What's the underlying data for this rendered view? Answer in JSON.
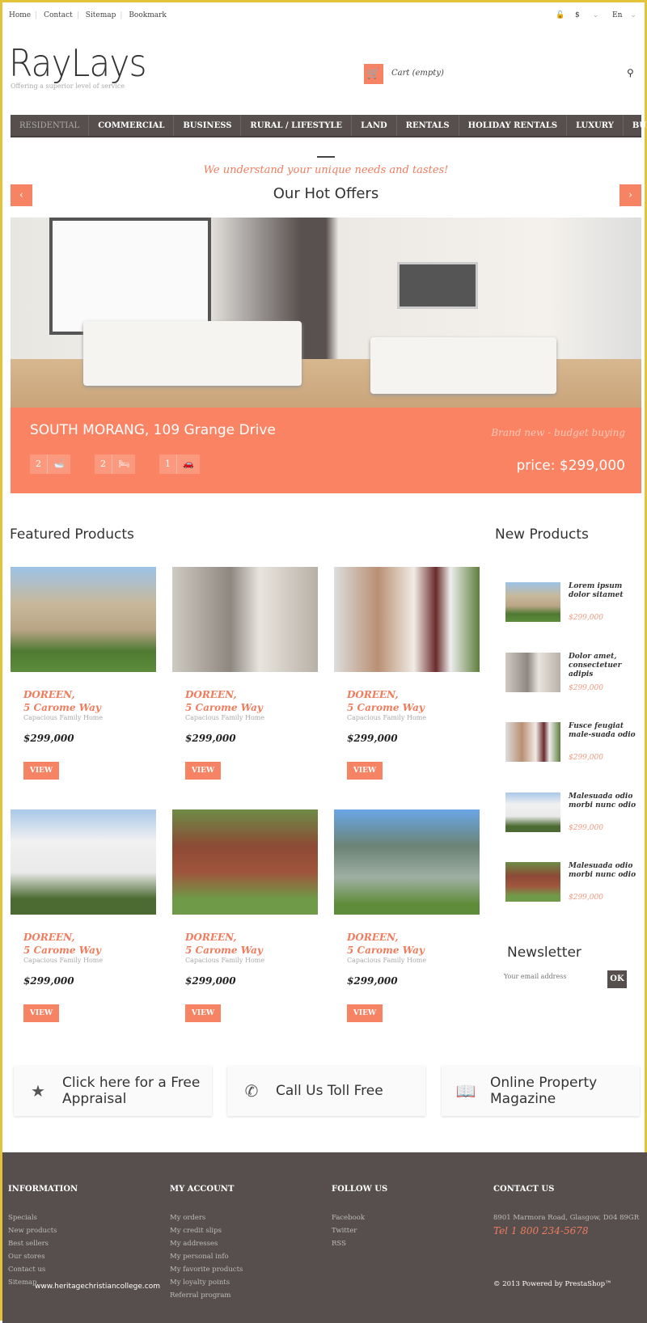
{
  "topnav": [
    "Home",
    "Contact",
    "Sitemap",
    "Bookmark"
  ],
  "top_right": {
    "currency": "$",
    "language": "En"
  },
  "logo": {
    "name": "RayLays",
    "slogan": "Offering a superior level of service"
  },
  "cart": {
    "label": "Cart (empty)"
  },
  "menu": [
    "RESIDENTIAL",
    "COMMERCIAL",
    "BUSINESS",
    "RURAL / LIFESTYLE",
    "LAND",
    "RENTALS",
    "HOLIDAY RENTALS",
    "LUXURY",
    "BUDGET"
  ],
  "slider": {
    "tagline": "We understand your unique needs and tastes!",
    "title": "Our Hot Offers",
    "address": "SOUTH MORANG, 109 Grange Drive",
    "subtitle": "Brand new - budget buying",
    "price": "price: $299,000",
    "baths": "2",
    "beds": "2",
    "cars": "1"
  },
  "featured": {
    "title": "Featured Products",
    "items": [
      {
        "name1": "DOREEN,",
        "name2": "5 Carome Way",
        "desc": "Capacious Family Home",
        "price": "$299,000",
        "button": "VIEW"
      },
      {
        "name1": "DOREEN,",
        "name2": "5 Carome Way",
        "desc": "Capacious Family Home",
        "price": "$299,000",
        "button": "VIEW"
      },
      {
        "name1": "DOREEN,",
        "name2": "5 Carome Way",
        "desc": "Capacious Family Home",
        "price": "$299,000",
        "button": "VIEW"
      },
      {
        "name1": "DOREEN,",
        "name2": "5 Carome Way",
        "desc": "Capacious Family Home",
        "price": "$299,000",
        "button": "VIEW"
      },
      {
        "name1": "DOREEN,",
        "name2": "5 Carome Way",
        "desc": "Capacious Family Home",
        "price": "$299,000",
        "button": "VIEW"
      },
      {
        "name1": "DOREEN,",
        "name2": "5 Carome Way",
        "desc": "Capacious Family Home",
        "price": "$299,000",
        "button": "VIEW"
      }
    ]
  },
  "new_products": {
    "title": "New Products",
    "items": [
      {
        "name": "Lorem ipsum dolor sitamet",
        "price": "$299,000"
      },
      {
        "name": "Dolor amet, consectetuer adipis",
        "price": "$299,000"
      },
      {
        "name": "Fusce feugiat male-suada odio",
        "price": "$299,000"
      },
      {
        "name": "Malesuada odio morbi nunc odio",
        "price": "$299,000"
      },
      {
        "name": "Malesuada odio morbi nunc odio",
        "price": "$299,000"
      }
    ]
  },
  "newsletter": {
    "title": "Newsletter",
    "placeholder": "Your email address",
    "button": "OK"
  },
  "boxes": [
    "Click here for a Free Appraisal",
    "Call Us Toll Free",
    "Online Property Magazine"
  ],
  "footer": {
    "information": {
      "title": "INFORMATION",
      "links": [
        "Specials",
        "New products",
        "Best sellers",
        "Our stores",
        "Contact us",
        "Sitemap"
      ]
    },
    "account": {
      "title": "MY ACCOUNT",
      "links": [
        "My orders",
        "My credit slips",
        "My addresses",
        "My personal info",
        "My favorite products",
        "My loyalty points",
        "Referral program"
      ]
    },
    "follow": {
      "title": "FOLLOW US",
      "links": [
        "Facebook",
        "Twitter",
        "RSS"
      ]
    },
    "contact": {
      "title": "CONTACT US",
      "address": "8901 Marmora Road, Glasgow, D04 89GR",
      "tel": "Tel 1 800 234-5678",
      "copyright": "© 2013 Powered by PrestaShop™"
    }
  },
  "watermark": "www.heritagechristiancollege.com",
  "colors": {
    "accent": "#f68363",
    "dark": "#574f4e"
  }
}
